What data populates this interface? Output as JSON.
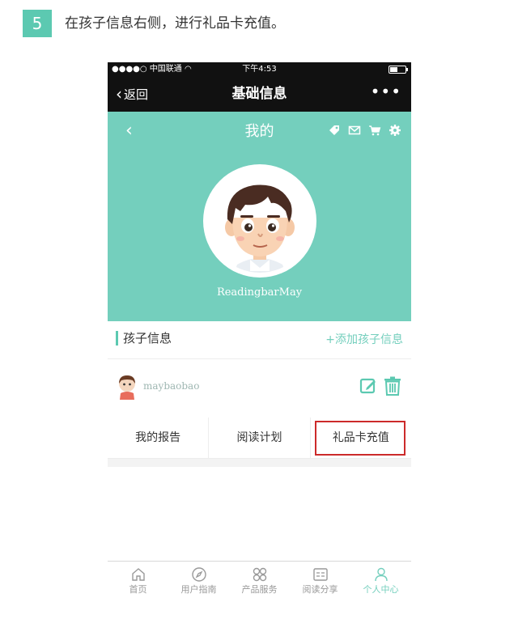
{
  "step": {
    "number": "5",
    "text": "在孩子信息右侧，进行礼品卡充值。"
  },
  "statusbar": {
    "carrier": "●●●●○ 中国联通 ",
    "time": "下午4:53"
  },
  "navbar": {
    "back_label": "返回",
    "title": "基础信息",
    "more_label": "•••"
  },
  "profile": {
    "back_glyph": "‹",
    "title": "我的",
    "icons": [
      "tag-icon",
      "mail-icon",
      "cart-icon",
      "gear-icon"
    ],
    "username": "ReadingbarMay",
    "bg_color": "#74cfbd"
  },
  "children_section": {
    "title": "孩子信息",
    "add_label": "+添加孩子信息",
    "child_name": "maybaobao"
  },
  "actions": {
    "items": [
      "我的报告",
      "阅读计划",
      "礼品卡充值"
    ],
    "highlighted": "礼品卡充值",
    "highlight_color": "#cc2a2a"
  },
  "tabbar": {
    "items": [
      {
        "label": "首页",
        "icon": "home-icon",
        "active": false
      },
      {
        "label": "用户指南",
        "icon": "compass-icon",
        "active": false
      },
      {
        "label": "产品服务",
        "icon": "grid-icon",
        "active": false
      },
      {
        "label": "阅读分享",
        "icon": "share-card-icon",
        "active": false
      },
      {
        "label": "个人中心",
        "icon": "user-icon",
        "active": true
      }
    ],
    "active_color": "#74cfbd"
  },
  "accent_color": "#5cc9b1"
}
